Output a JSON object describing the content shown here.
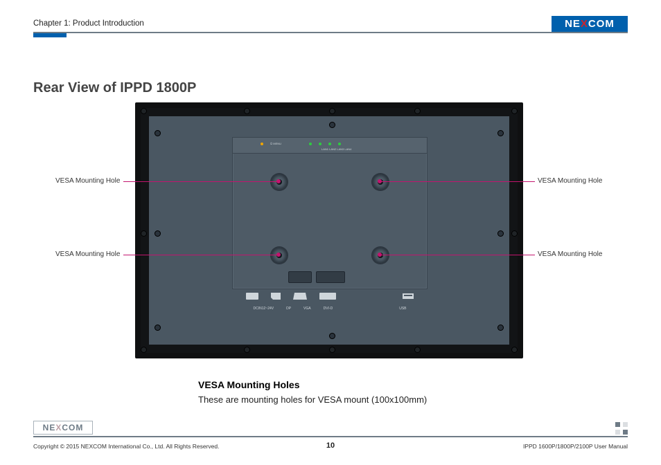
{
  "header": {
    "chapter": "Chapter 1: Product Introduction",
    "logo_text_pre": "NE",
    "logo_text_x": "X",
    "logo_text_post": "COM"
  },
  "title": "Rear View of IPPD 1800P",
  "callouts": {
    "top_left": "VESA Mounting Hole",
    "bottom_left": "VESA Mounting Hole",
    "top_right": "VESA Mounting Hole",
    "bottom_right": "VESA Mounting Hole"
  },
  "plate_labels": {
    "led_group_left": "⏻   MENU",
    "led_group_right": "LAN1 LAN2 LAN3 LAN4",
    "ports": {
      "p1": "DCIN12~24V",
      "p2": "DP",
      "p3": "VGA",
      "p4": "DVI-D",
      "p5": "USB"
    }
  },
  "description": {
    "heading": "VESA Mounting Holes",
    "body": "These are mounting holes for VESA mount (100x100mm)"
  },
  "footer": {
    "logo_pre": "NE",
    "logo_x": "X",
    "logo_post": "COM",
    "copyright": "Copyright © 2015 NEXCOM International Co., Ltd. All Rights Reserved.",
    "page": "10",
    "docname": "IPPD 1600P/1800P/2100P User Manual"
  }
}
